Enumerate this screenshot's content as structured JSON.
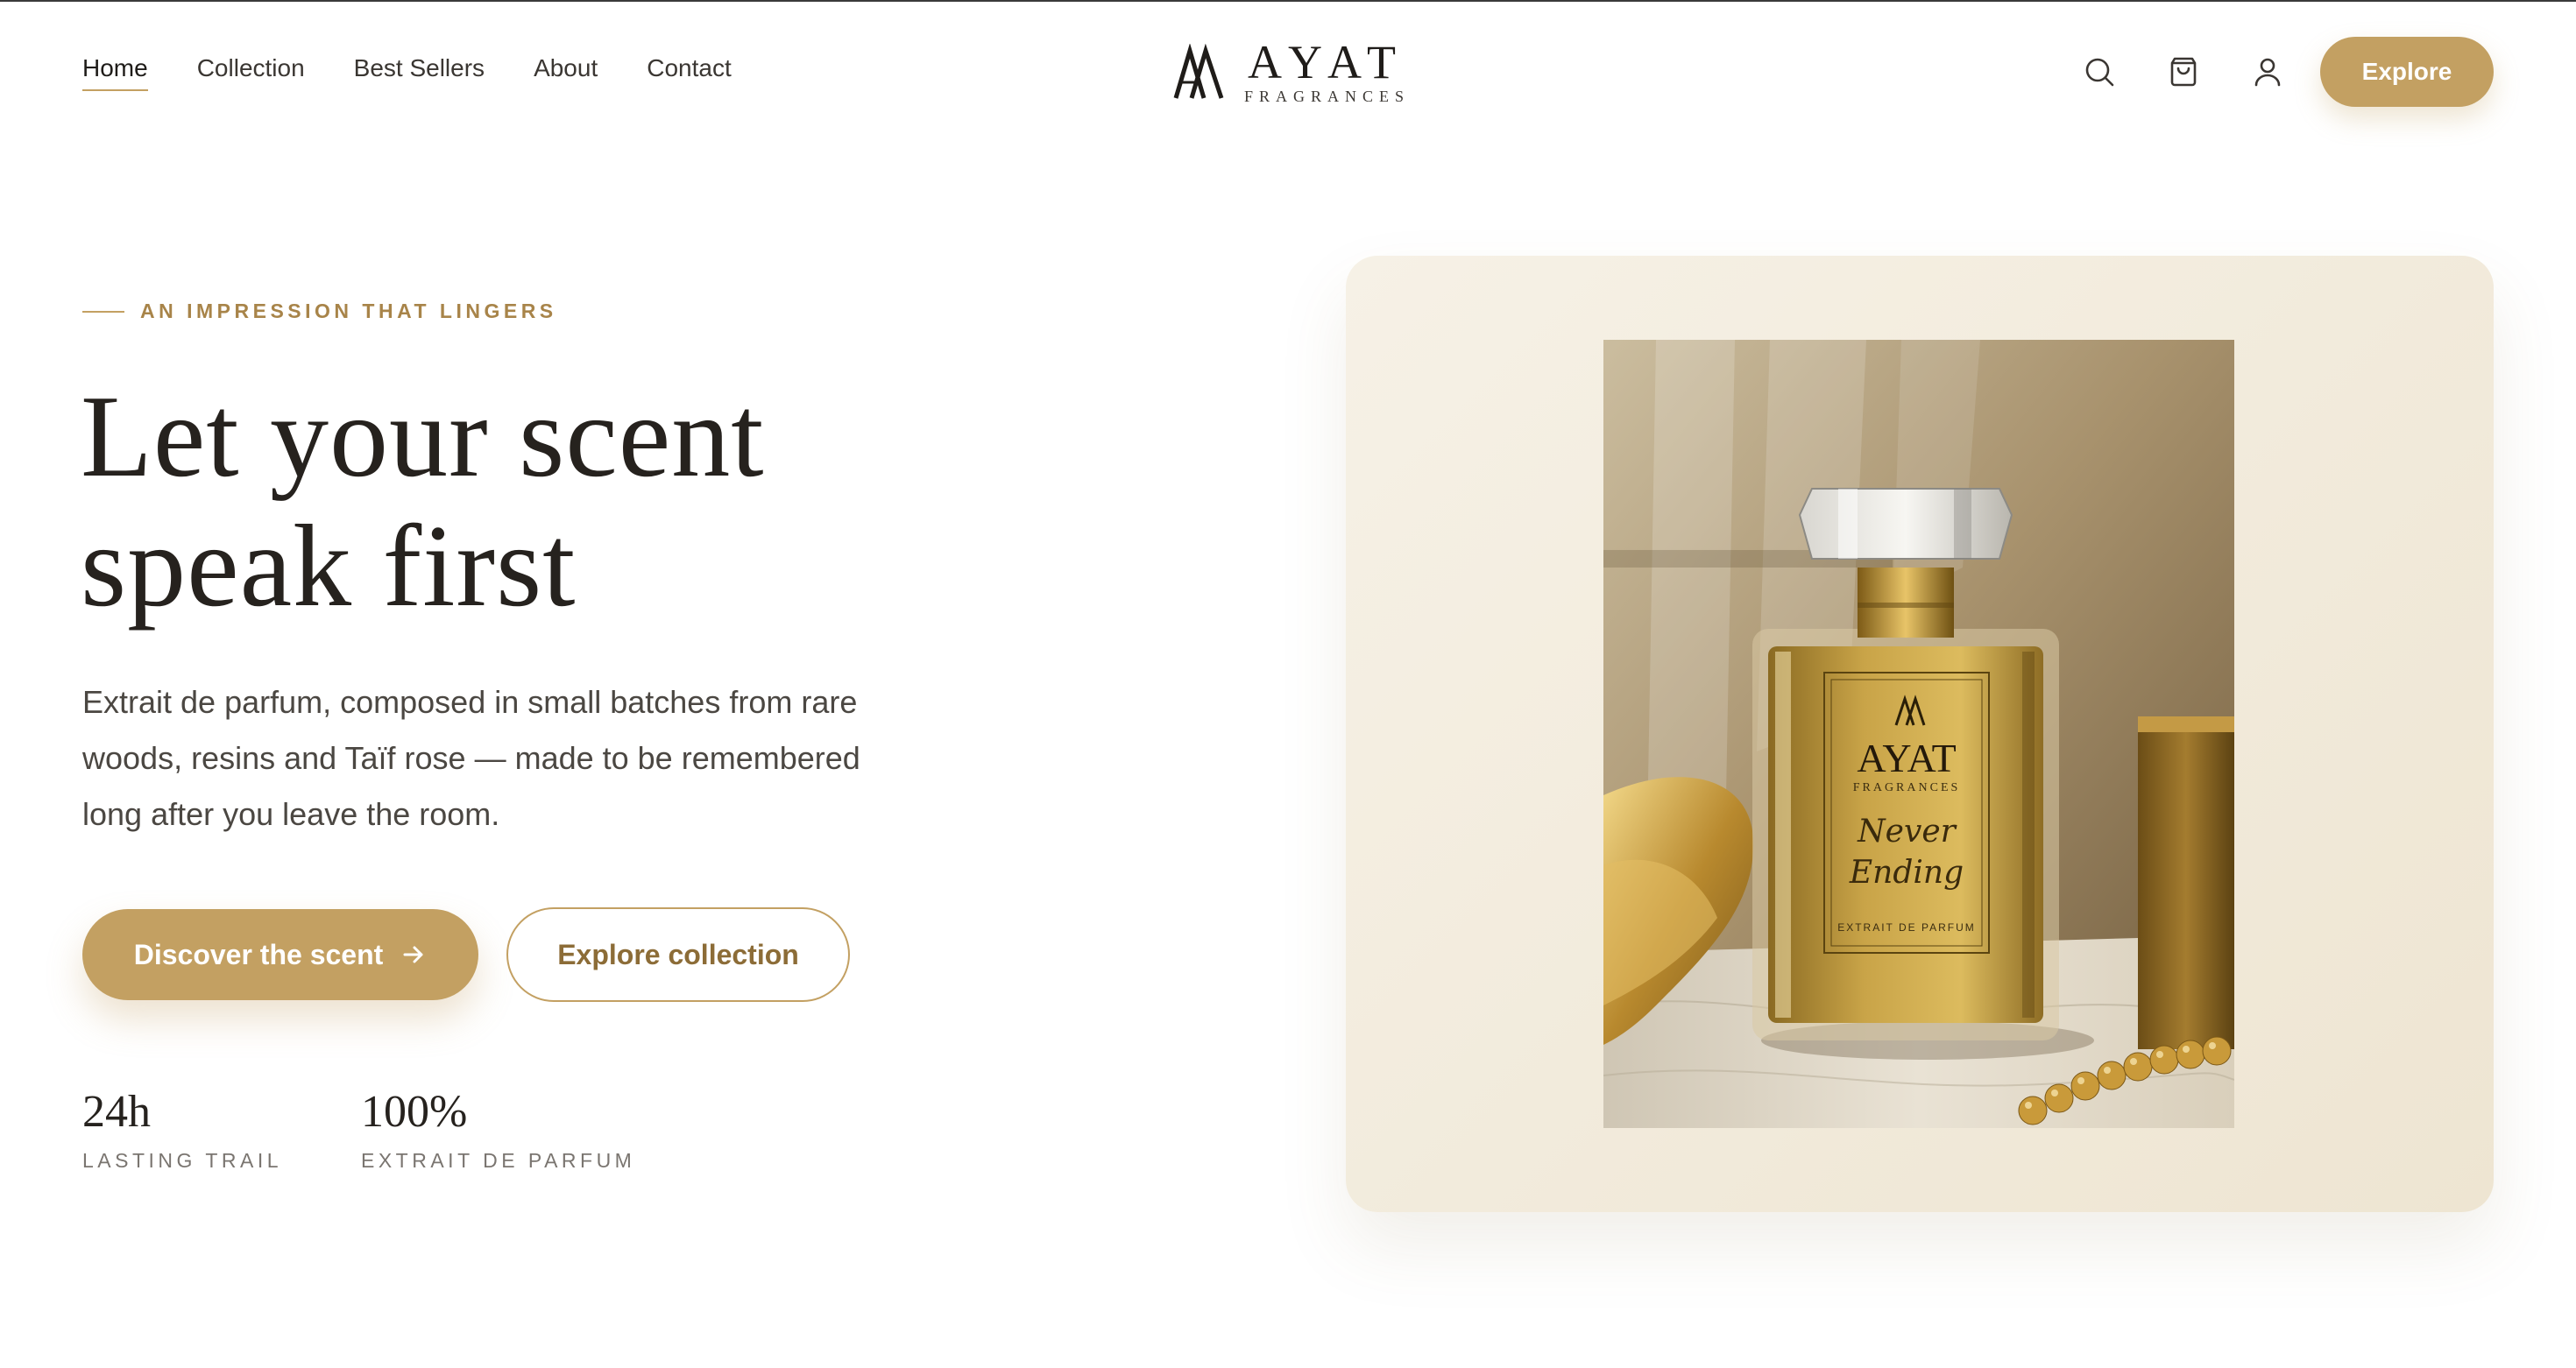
{
  "header": {
    "nav": [
      {
        "label": "Home",
        "active": true
      },
      {
        "label": "Collection",
        "active": false
      },
      {
        "label": "Best Sellers",
        "active": false
      },
      {
        "label": "About",
        "active": false
      },
      {
        "label": "Contact",
        "active": false
      }
    ],
    "logo": {
      "name": "AYAT",
      "sub": "FRAGRANCES"
    },
    "icons": [
      "search-icon",
      "bag-icon",
      "user-icon"
    ],
    "cta_label": "Explore"
  },
  "hero": {
    "eyebrow": "AN IMPRESSION THAT LINGERS",
    "headline_line1": "Let your scent",
    "headline_line2": "speak first",
    "description": "Extrait de parfum, composed in small batches from rare woods, resins and Taïf rose — made to be remembered long after you leave the room.",
    "primary_button": "Discover the scent",
    "secondary_button": "Explore collection",
    "stats": [
      {
        "value": "24h",
        "label": "LASTING TRAIL"
      },
      {
        "value": "100%",
        "label": "EXTRAIT DE PARFUM"
      }
    ]
  },
  "product_image": {
    "brand": "AYAT",
    "brand_sub": "FRAGRANCES",
    "name_line1": "Never",
    "name_line2": "Ending",
    "type": "EXTRAIT DE PARFUM"
  },
  "colors": {
    "accent": "#c3a062",
    "accent_dark": "#a88449",
    "text": "#26221e",
    "card_bg": "#f3ecdc"
  }
}
